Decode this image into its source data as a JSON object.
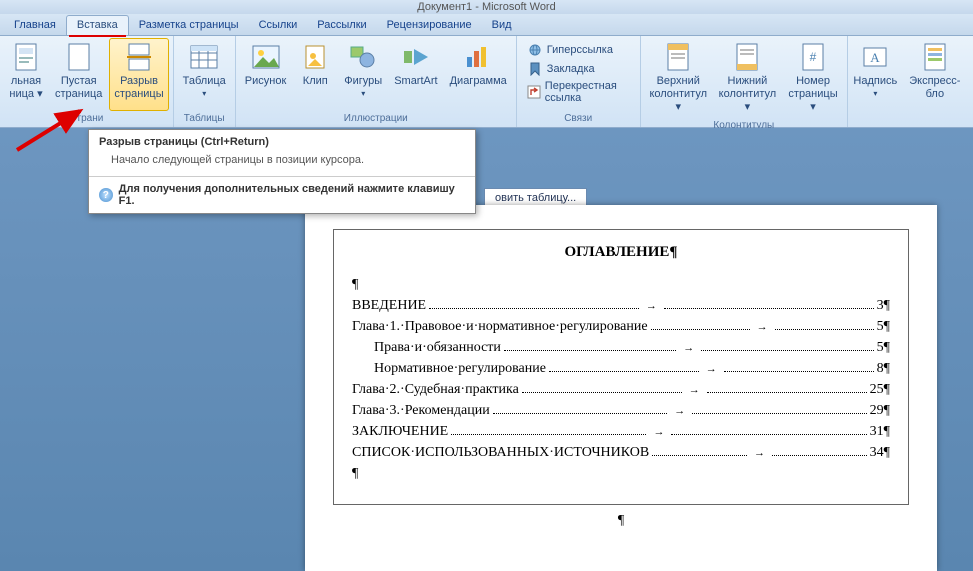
{
  "title_bar": "Документ1 - Microsoft Word",
  "tabs": {
    "home": "Главная",
    "insert": "Вставка",
    "page_layout": "Разметка страницы",
    "references": "Ссылки",
    "mailings": "Рассылки",
    "review": "Рецензирование",
    "view": "Вид"
  },
  "ribbon": {
    "pages": {
      "cover_page": "льная\nница ▾",
      "blank_page": "Пустая\nстраница",
      "page_break": "Разрыв\nстраницы",
      "group": "Страни"
    },
    "tables": {
      "table": "Таблица",
      "group": "Таблицы"
    },
    "illustrations": {
      "picture": "Рисунок",
      "clip": "Клип",
      "shapes": "Фигуры",
      "smartart": "SmartArt",
      "chart": "Диаграмма",
      "group": "Иллюстрации"
    },
    "links": {
      "hyperlink": "Гиперссылка",
      "bookmark": "Закладка",
      "crossref": "Перекрестная ссылка",
      "group": "Связи"
    },
    "header_footer": {
      "header": "Верхний\nколонтитул ▾",
      "footer": "Нижний\nколонтитул ▾",
      "page_num": "Номер\nстраницы ▾",
      "group": "Колонтитулы"
    },
    "text": {
      "textbox": "Надпись",
      "quickparts": "Экспресс-бло"
    }
  },
  "tooltip": {
    "title": "Разрыв страницы (Ctrl+Return)",
    "desc": "Начало следующей страницы в позиции курсора.",
    "help": "Для получения дополнительных сведений нажмите клавишу F1."
  },
  "sub_tab": "овить таблицу...",
  "document": {
    "heading": "ОГЛАВЛЕНИЕ",
    "toc": [
      {
        "text": "ВВЕДЕНИЕ",
        "page": "3",
        "indent": false
      },
      {
        "text": "Глава·1.·Правовое·и·нормативное·регулирование",
        "page": "5",
        "indent": false
      },
      {
        "text": "Права·и·обязанности",
        "page": "5",
        "indent": true
      },
      {
        "text": "Нормативное·регулирование",
        "page": "8",
        "indent": true
      },
      {
        "text": "Глава·2.·Судебная·практика",
        "page": "25",
        "indent": false
      },
      {
        "text": "Глава·3.·Рекомендации",
        "page": "29",
        "indent": false
      },
      {
        "text": "ЗАКЛЮЧЕНИЕ",
        "page": "31",
        "indent": false
      },
      {
        "text": "СПИСОК·ИСПОЛЬЗОВАННЫХ·ИСТОЧНИКОВ",
        "page": "34",
        "indent": false
      }
    ]
  }
}
